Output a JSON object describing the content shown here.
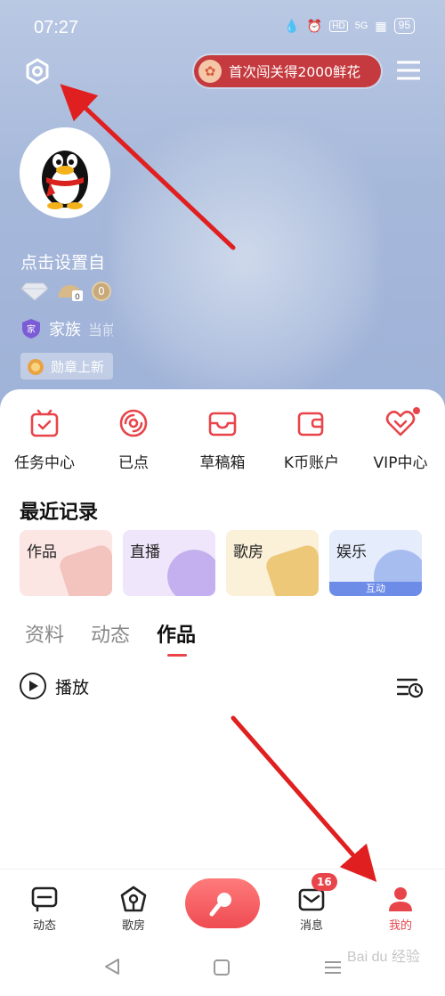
{
  "status_bar": {
    "time": "07:27",
    "network": "5G",
    "battery": "95"
  },
  "header": {
    "promo_text": "首次闯关得2000鲜花",
    "nickname_hint": "点击设置自",
    "coin_value": "0",
    "helmet_value": "0",
    "family_label": "家族",
    "family_sub": "当前",
    "medal_text": "勋章上新"
  },
  "shortcuts": [
    {
      "label": "任务中心",
      "icon": "task-center-icon"
    },
    {
      "label": "已点",
      "icon": "ordered-songs-icon"
    },
    {
      "label": "草稿箱",
      "icon": "drafts-icon"
    },
    {
      "label": "K币账户",
      "icon": "wallet-icon"
    },
    {
      "label": "VIP中心",
      "icon": "vip-heart-icon"
    }
  ],
  "recent": {
    "title": "最近记录",
    "cards": [
      {
        "label": "作品"
      },
      {
        "label": "直播"
      },
      {
        "label": "歌房"
      },
      {
        "label": "娱乐",
        "tag": "互动"
      }
    ]
  },
  "profile_tabs": [
    "资料",
    "动态",
    "作品"
  ],
  "active_tab": "作品",
  "play_label": "播放",
  "bottom_nav": {
    "items": [
      "动态",
      "歌房",
      "消息",
      "我的"
    ],
    "message_badge": "16",
    "active": "我的"
  },
  "watermark": "Bai du 经验",
  "colors": {
    "accent": "#e8454b",
    "header_bg": "#a6b8da",
    "annotation_arrow": "#e02020"
  }
}
